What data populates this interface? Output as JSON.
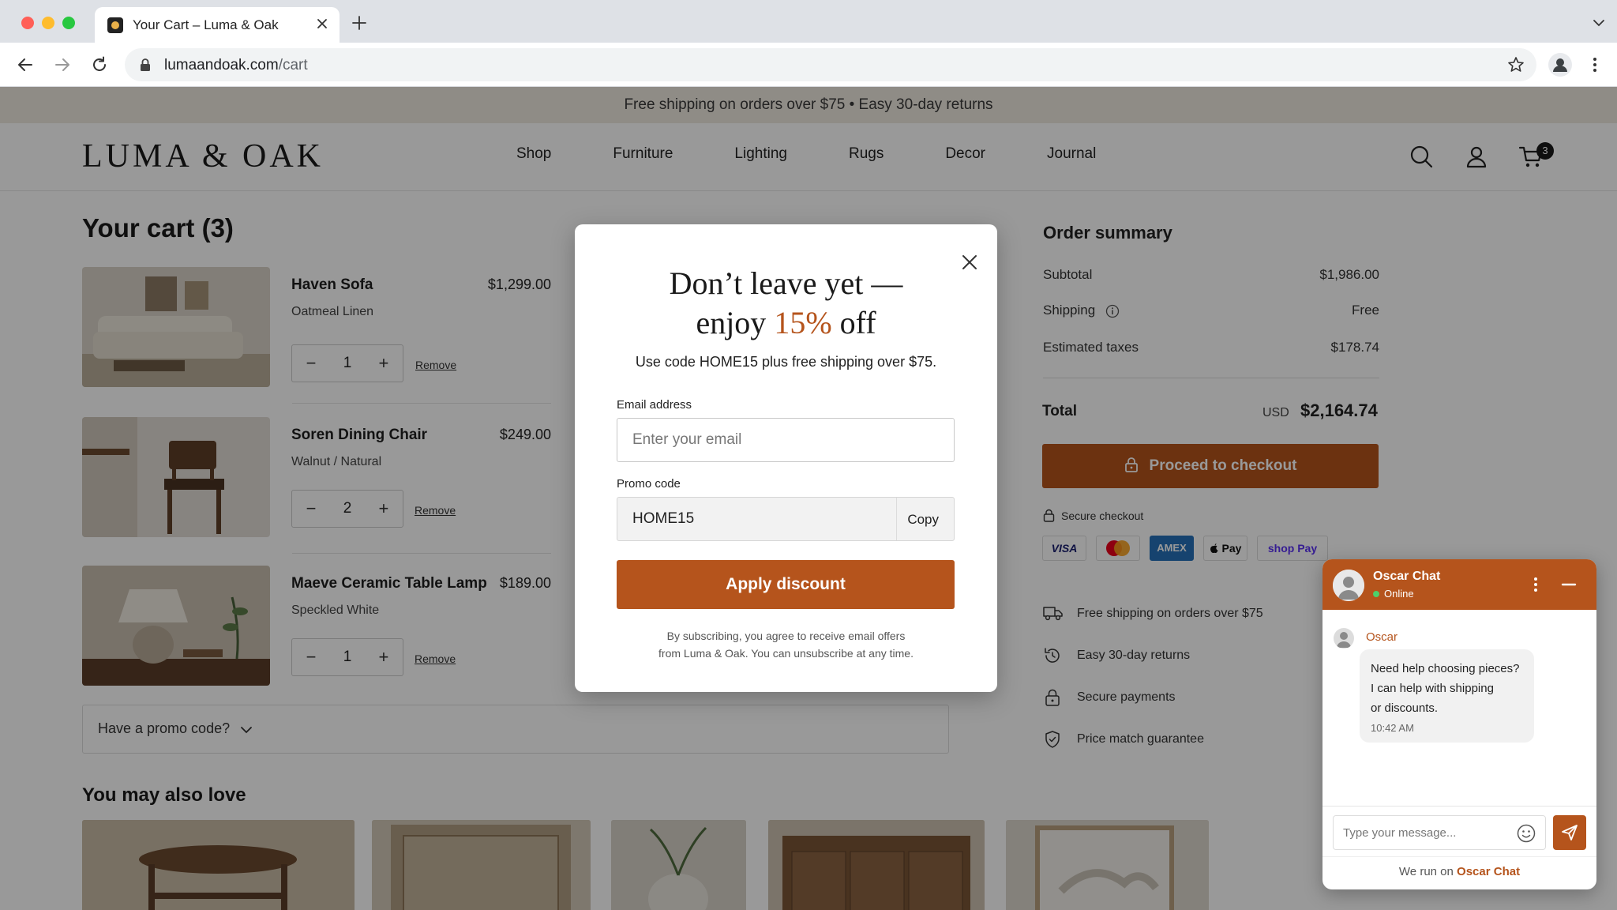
{
  "browser": {
    "tab_title": "Your Cart – Luma & Oak",
    "url_domain": "lumaandoak.com",
    "url_path": "/cart"
  },
  "site": {
    "announcement": "Free shipping on orders over $75 • Easy 30-day returns",
    "logo": "LUMA & OAK",
    "nav": [
      "Shop",
      "Furniture",
      "Lighting",
      "Rugs",
      "Decor",
      "Journal"
    ],
    "cart_count": "3"
  },
  "cart": {
    "title": "Your cart (3)",
    "remove_label": "Remove",
    "items": [
      {
        "name": "Haven Sofa",
        "variant": "Oatmeal Linen",
        "price": "$1,299.00",
        "qty": "1"
      },
      {
        "name": "Soren Dining Chair",
        "variant": "Walnut / Natural",
        "price": "$249.00",
        "qty": "2"
      },
      {
        "name": "Maeve Ceramic Table Lamp",
        "variant": "Speckled White",
        "price": "$189.00",
        "qty": "1"
      }
    ],
    "promo_toggle": "Have a promo code?",
    "recommendations_title": "You may also love"
  },
  "summary": {
    "title": "Order summary",
    "subtotal_label": "Subtotal",
    "subtotal": "$1,986.00",
    "shipping_label": "Shipping",
    "shipping": "Free",
    "taxes_label": "Estimated taxes",
    "taxes": "$178.74",
    "total_label": "Total",
    "currency": "USD",
    "total": "$2,164.74",
    "checkout_label": "Proceed to checkout",
    "secure_label": "Secure checkout",
    "payments": [
      "VISA",
      "Mastercard",
      "AMEX",
      "Apple Pay",
      "shop Pay"
    ],
    "features": [
      "Free shipping on orders over $75",
      "Easy 30-day returns",
      "Secure payments",
      "Price match guarantee"
    ]
  },
  "modal": {
    "title_line1": "Don’t leave yet —",
    "title_line2_pre": "enjoy ",
    "title_accent": "15%",
    "title_line2_post": " off",
    "subtitle": "Use code HOME15 plus free shipping over $75.",
    "email_label": "Email address",
    "email_placeholder": "Enter your email",
    "promo_label": "Promo code",
    "promo_code": "HOME15",
    "copy_label": "Copy",
    "apply_label": "Apply discount",
    "fine_line1": "By subscribing, you agree to receive email offers",
    "fine_line2": "from Luma & Oak. You can unsubscribe at any time."
  },
  "chat": {
    "name": "Oscar Chat",
    "status": "Online",
    "agent": "Oscar",
    "message_lines": [
      "Need help choosing pieces?",
      "I can help with shipping",
      "or discounts."
    ],
    "time": "10:42 AM",
    "input_placeholder": "Type your message...",
    "footer_pre": "We run on ",
    "footer_brand": "Oscar Chat"
  },
  "colors": {
    "accent": "#b5541c",
    "announcement_bg": "#efe9e0",
    "online": "#4cd06a"
  }
}
